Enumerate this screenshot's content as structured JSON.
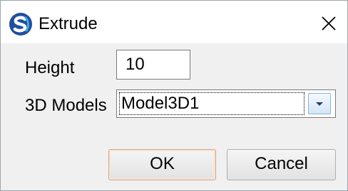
{
  "window": {
    "title": "Extrude",
    "icon": "app-logo-icon",
    "close_icon": "close-icon"
  },
  "form": {
    "height_label": "Height",
    "height_value": "10",
    "models_label": "3D Models",
    "models_selected": "Model3D1",
    "dropdown_icon": "chevron-down-icon"
  },
  "buttons": {
    "ok_label": "OK",
    "cancel_label": "Cancel"
  },
  "colors": {
    "icon_blue": "#1f4fa0",
    "icon_light_blue": "#3fa9e0",
    "ok_border": "#d9a37a",
    "dropdown_border": "#8bb3d8"
  }
}
